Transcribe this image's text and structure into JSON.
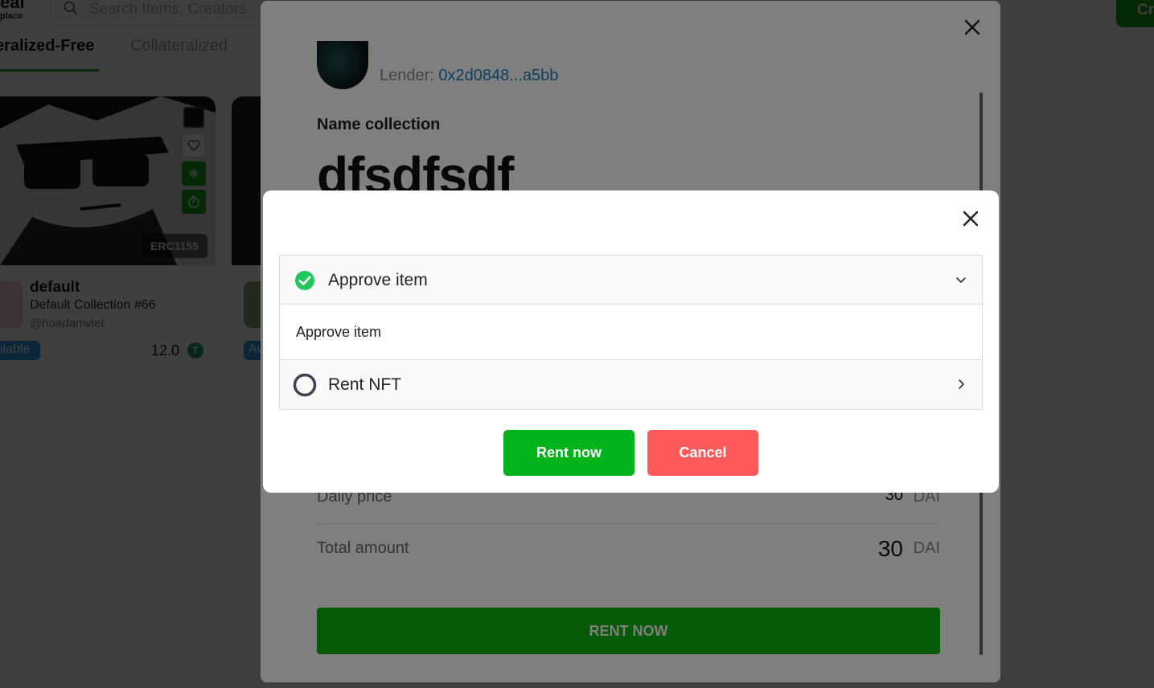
{
  "background": {
    "logo_top": "eal",
    "logo_sub": "place",
    "search_placeholder": "Search Items, Creators",
    "create_label": "Cr",
    "tabs": [
      "eralized-Free",
      "Collateralized"
    ],
    "card": {
      "erc_badge": "ERC1155",
      "title": "default",
      "collection": "Default Collection #66",
      "handle": "@hoadamviet",
      "status": "ilable",
      "price": "12.0",
      "price_token_icon": "T"
    },
    "card2_status": "Av"
  },
  "detail_modal": {
    "lender_label": "Lender:",
    "lender_address": "0x2d0848...a5bb",
    "name_collection_label": "Name collection",
    "name_value": "dfsdfsdf",
    "daily_price_label": "Daily price",
    "daily_price_value": "30",
    "daily_price_unit": "DAI",
    "total_amount_label": "Total amount",
    "total_amount_value": "30",
    "total_amount_unit": "DAI",
    "rent_button": "RENT NOW"
  },
  "confirm_dialog": {
    "steps": [
      {
        "label": "Approve item",
        "status": "complete",
        "expanded": true,
        "body": "Approve item"
      },
      {
        "label": "Rent NFT",
        "status": "pending",
        "expanded": false
      }
    ],
    "rent_now_label": "Rent now",
    "cancel_label": "Cancel"
  },
  "colors": {
    "accent_green": "#00b31b",
    "cancel_red": "#ff5a5a",
    "link_blue": "#1c7fb8",
    "check_green": "#22c55e"
  }
}
